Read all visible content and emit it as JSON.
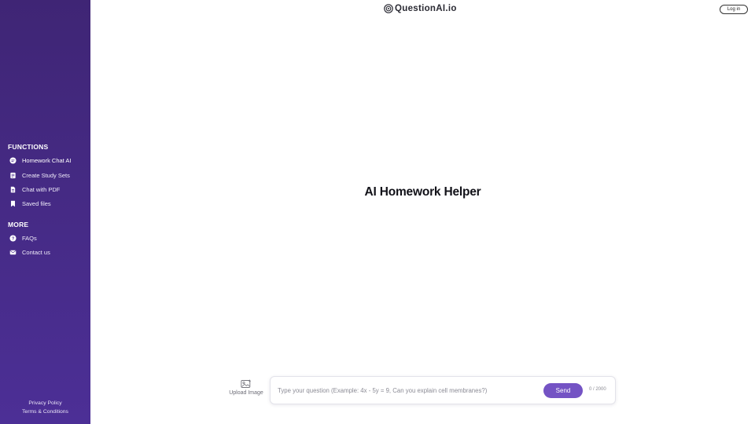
{
  "header": {
    "logo_text": "QuestionAI.io",
    "login_label": "Log in"
  },
  "sidebar": {
    "functions_title": "FUNCTIONS",
    "functions": [
      {
        "label": "Homework Chat AI",
        "icon": "chat-bubble-icon"
      },
      {
        "label": "Create Study Sets",
        "icon": "cards-icon"
      },
      {
        "label": "Chat with PDF",
        "icon": "document-icon"
      },
      {
        "label": "Saved files",
        "icon": "bookmark-icon"
      }
    ],
    "more_title": "MORE",
    "more": [
      {
        "label": "FAQs",
        "icon": "question-circle-icon"
      },
      {
        "label": "Contact us",
        "icon": "envelope-icon"
      }
    ],
    "footer": {
      "privacy": "Privacy Policy",
      "terms": "Terms & Conditions"
    }
  },
  "main": {
    "title": "AI Homework Helper",
    "upload_label": "Upload Image",
    "input": {
      "value": "",
      "placeholder": "Type your question (Example: 4x - 5y = 9, Can you explain cell membranes?)"
    },
    "send_label": "Send",
    "char_count": "0 / 2000"
  },
  "colors": {
    "sidebar_top": "#3f2575",
    "sidebar_bottom": "#4c2f96",
    "accent": "#7453c4"
  }
}
